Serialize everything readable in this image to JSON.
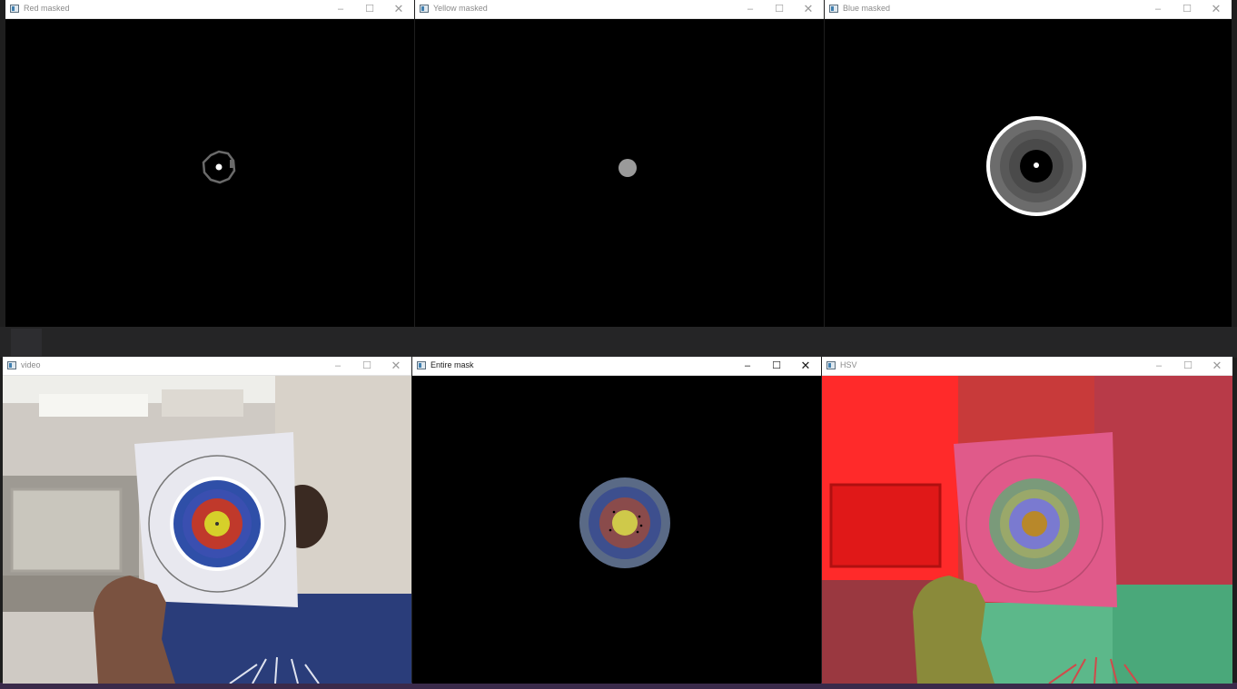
{
  "windows": {
    "red_masked": {
      "title": "Red masked",
      "minimize": "–",
      "maximize": "☐",
      "close": "✕"
    },
    "yellow_masked": {
      "title": "Yellow masked",
      "minimize": "–",
      "maximize": "☐",
      "close": "✕"
    },
    "blue_masked": {
      "title": "Blue masked",
      "minimize": "–",
      "maximize": "☐",
      "close": "✕"
    },
    "video": {
      "title": "video",
      "minimize": "–",
      "maximize": "☐",
      "close": "✕"
    },
    "entire_mask": {
      "title": "Entire mask",
      "minimize": "–",
      "maximize": "☐",
      "close": "✕",
      "active": true
    },
    "hsv": {
      "title": "HSV",
      "minimize": "–",
      "maximize": "☐",
      "close": "✕"
    }
  },
  "icons": {
    "window_icon": "opencv-window-icon",
    "minimize": "minimize-icon",
    "maximize": "maximize-icon",
    "close": "close-icon"
  },
  "colors": {
    "titlebar": "#ffffff",
    "canvas_background": "#000000",
    "detection_circle": "#ffffff",
    "target_blue": "#2f4fa8",
    "target_red": "#c0392b",
    "target_yellow": "#d6d02a"
  }
}
